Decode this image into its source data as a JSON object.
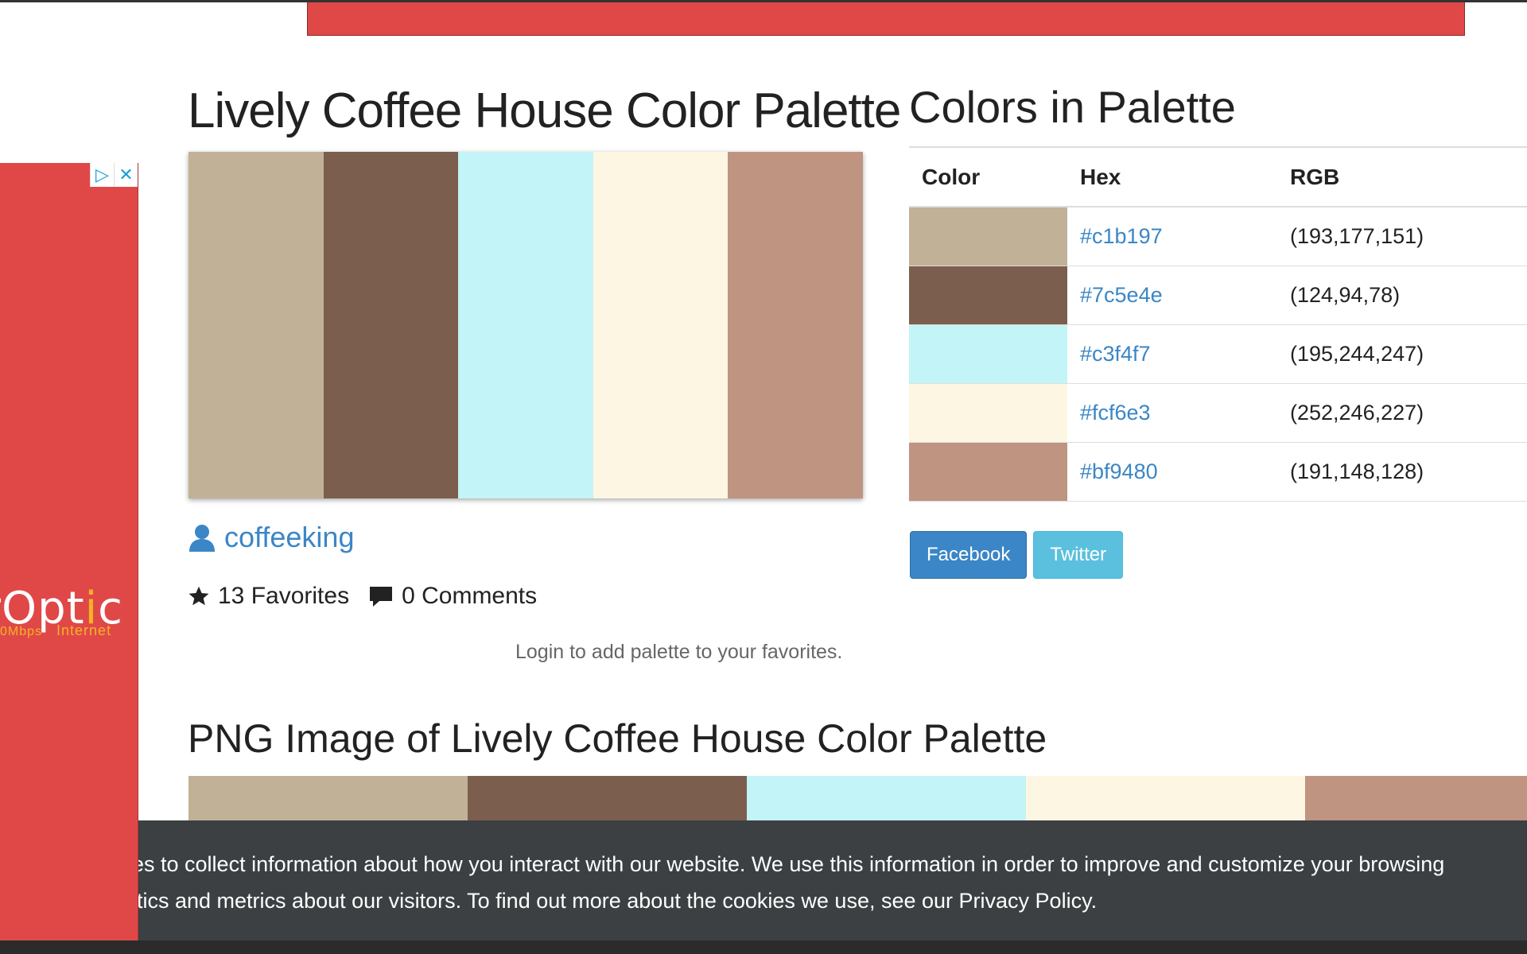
{
  "page": {
    "title": "Lively Coffee House Color Palette",
    "colors_heading": "Colors in Palette",
    "png_heading": "PNG Image of Lively Coffee House Color Palette"
  },
  "palette": [
    "#c1b197",
    "#7c5e4e",
    "#c3f4f7",
    "#fcf6e3",
    "#bf9480"
  ],
  "author": {
    "name": "coffeeking",
    "icon": "user-icon"
  },
  "stats": {
    "favorites": "13 Favorites",
    "comments": "0 Comments",
    "favorites_icon": "star-icon",
    "comments_icon": "comment-icon"
  },
  "login_note": "Login to add palette to your favorites.",
  "table": {
    "headers": [
      "Color",
      "Hex",
      "RGB"
    ],
    "rows": [
      {
        "hex": "#c1b197",
        "rgb": "(193,177,151)"
      },
      {
        "hex": "#7c5e4e",
        "rgb": "(124,94,78)"
      },
      {
        "hex": "#c3f4f7",
        "rgb": "(195,244,247)"
      },
      {
        "hex": "#fcf6e3",
        "rgb": "(252,246,227)"
      },
      {
        "hex": "#bf9480",
        "rgb": "(191,148,128)"
      }
    ]
  },
  "share": {
    "facebook": "Facebook",
    "twitter": "Twitter"
  },
  "ad": {
    "brand_prefix": "rOpt",
    "brand_i": "i",
    "brand_suffix": "c",
    "tag_speed": "0Mbps",
    "tag_internet": "Internet",
    "color": "#e04848"
  },
  "cookie": {
    "line1": "es to collect information about how you interact with our website. We use this information in order to improve and customize your browsing",
    "line2": "tics and metrics about our visitors. To find out more about the cookies we use, see our ",
    "policy_link": "Privacy Policy",
    "line2_end": "."
  }
}
